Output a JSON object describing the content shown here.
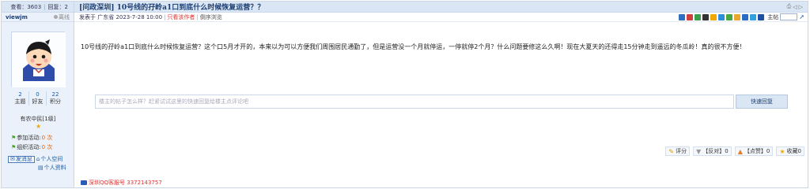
{
  "stats": {
    "views_label": "查看：",
    "views": "3603",
    "replies_label": "回复：",
    "replies": "2"
  },
  "author": {
    "username": "viewjm",
    "online_label": "离线",
    "counts": [
      {
        "value": "2",
        "label": "主题"
      },
      {
        "value": "0",
        "label": "好友"
      },
      {
        "value": "22",
        "label": "积分"
      }
    ],
    "grade": "有农中民[1级]",
    "activity": [
      {
        "label": "参加活动:",
        "value": "0 次"
      },
      {
        "label": "组织活动:",
        "value": "0 次"
      }
    ],
    "message_button": "发消息",
    "space_link": "个人空间",
    "profile_link": "个人资料"
  },
  "post": {
    "title": "[问政深圳] 10号线的孖岭a1口到底什么时候恢复运营？？",
    "meta": {
      "posted_in": "发表于 广东省 2023-7-28 10:00",
      "author_only": "只看该作者",
      "reverse": "倒序浏览"
    },
    "move_label": "主帖",
    "content": "10号线的孖岭a1口到底什么时候恢复运营？这个口5月才开的，本来以为可以方便我们周围居民通勤了，但是运营没一个月就停运，一停就停2个月？什么问题要修这么久啊！现在大夏天的还得走15分钟走到遥远的冬瓜岭！真的很不方便！",
    "reply_placeholder": "楼主的帖子怎么样？赶紧试试这里的快速回复给楼主点评论吧",
    "reply_button": "快速回复",
    "actions": [
      {
        "icon": "rate-icon",
        "label": "评分"
      },
      {
        "icon": "oppose-icon",
        "label": "【反对】0"
      },
      {
        "icon": "support-icon",
        "label": "【点赞】0"
      },
      {
        "icon": "favorite-icon",
        "label": "收藏0"
      }
    ],
    "qq_label": "深圳QQ客服号 3372143757"
  },
  "colors": {
    "accent": "#1c3f73",
    "header_bg": "#dbe6f4",
    "warning": "#e03030"
  }
}
